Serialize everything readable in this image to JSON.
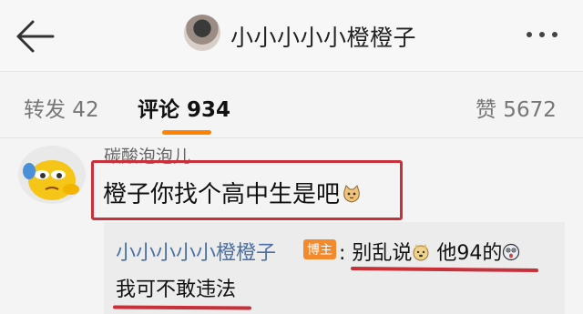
{
  "header": {
    "title": "小小小小小橙橙子",
    "back_icon": "back-arrow-icon",
    "more_icon": "more-dots-icon"
  },
  "tabs": {
    "repost": "转发 42",
    "comment": "评论 934",
    "like": "赞 5672",
    "active_color": "#ff8200"
  },
  "comment": {
    "author": "碳酸泡泡儿",
    "text": "橙子你找个高中生是吧",
    "emoji": "cat-emoji",
    "highlight_color": "#c8303a"
  },
  "reply": {
    "author": "小小小小小橙橙子",
    "badge": "博主",
    "text_part1": ": 别乱说",
    "text_part2": " 他94的",
    "text_line2": "我可不敢违法",
    "author_color": "#4a6fa5",
    "badge_color": "#f48a2c"
  }
}
